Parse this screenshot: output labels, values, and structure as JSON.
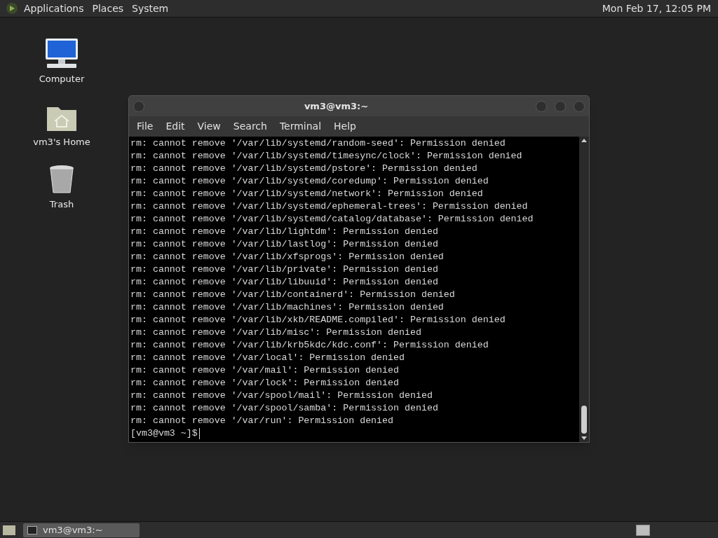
{
  "top_panel": {
    "menus": [
      "Applications",
      "Places",
      "System"
    ],
    "clock": "Mon Feb 17, 12:05 PM"
  },
  "desktop_icons": [
    {
      "kind": "computer",
      "label": "Computer"
    },
    {
      "kind": "home",
      "label": "vm3's Home"
    },
    {
      "kind": "trash",
      "label": "Trash"
    }
  ],
  "terminal": {
    "title": "vm3@vm3:~",
    "menu": [
      "File",
      "Edit",
      "View",
      "Search",
      "Terminal",
      "Help"
    ],
    "lines": [
      "rm: cannot remove '/var/lib/systemd/random-seed': Permission denied",
      "rm: cannot remove '/var/lib/systemd/timesync/clock': Permission denied",
      "rm: cannot remove '/var/lib/systemd/pstore': Permission denied",
      "rm: cannot remove '/var/lib/systemd/coredump': Permission denied",
      "rm: cannot remove '/var/lib/systemd/network': Permission denied",
      "rm: cannot remove '/var/lib/systemd/ephemeral-trees': Permission denied",
      "rm: cannot remove '/var/lib/systemd/catalog/database': Permission denied",
      "rm: cannot remove '/var/lib/lightdm': Permission denied",
      "rm: cannot remove '/var/lib/lastlog': Permission denied",
      "rm: cannot remove '/var/lib/xfsprogs': Permission denied",
      "rm: cannot remove '/var/lib/private': Permission denied",
      "rm: cannot remove '/var/lib/libuuid': Permission denied",
      "rm: cannot remove '/var/lib/containerd': Permission denied",
      "rm: cannot remove '/var/lib/machines': Permission denied",
      "rm: cannot remove '/var/lib/xkb/README.compiled': Permission denied",
      "rm: cannot remove '/var/lib/misc': Permission denied",
      "rm: cannot remove '/var/lib/krb5kdc/kdc.conf': Permission denied",
      "rm: cannot remove '/var/local': Permission denied",
      "rm: cannot remove '/var/mail': Permission denied",
      "rm: cannot remove '/var/lock': Permission denied",
      "rm: cannot remove '/var/spool/mail': Permission denied",
      "rm: cannot remove '/var/spool/samba': Permission denied",
      "rm: cannot remove '/var/run': Permission denied"
    ],
    "prompt": "[vm3@vm3 ~]$"
  },
  "taskbar": {
    "tasks": [
      {
        "label": "vm3@vm3:~",
        "selected": true
      }
    ]
  }
}
